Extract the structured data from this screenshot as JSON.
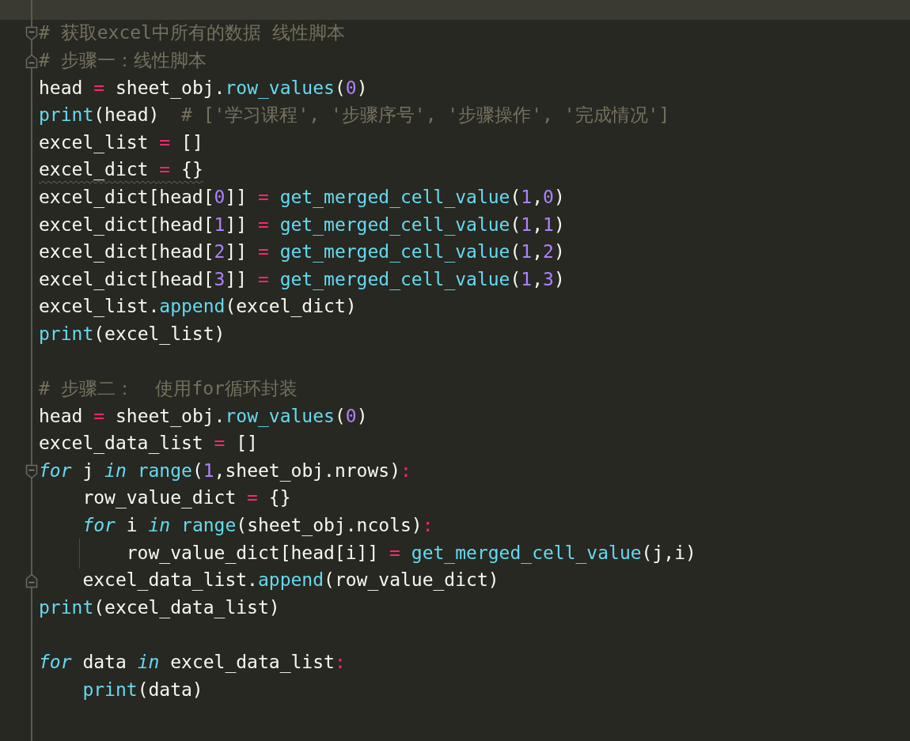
{
  "editor": {
    "lines": [
      {
        "kind": "code",
        "fold_start": true,
        "fold_end": false,
        "squiggle": false,
        "guide": false,
        "segments": [
          {
            "kind": "cm",
            "text": "# 获取excel中所有的数据 线性脚本"
          }
        ]
      },
      {
        "kind": "code",
        "fold_start": false,
        "fold_end": true,
        "squiggle": false,
        "guide": false,
        "segments": [
          {
            "kind": "cm",
            "text": "# 步骤一：线性脚本"
          }
        ]
      },
      {
        "kind": "code",
        "fold_start": false,
        "fold_end": false,
        "squiggle": false,
        "guide": false,
        "segments": [
          {
            "kind": "t",
            "text": "head "
          },
          {
            "kind": "op",
            "text": "="
          },
          {
            "kind": "t",
            "text": " sheet_obj."
          },
          {
            "kind": "fn",
            "text": "row_values"
          },
          {
            "kind": "t",
            "text": "("
          },
          {
            "kind": "num",
            "text": "0"
          },
          {
            "kind": "t",
            "text": ")"
          }
        ]
      },
      {
        "kind": "code",
        "fold_start": false,
        "fold_end": false,
        "squiggle": false,
        "guide": false,
        "segments": [
          {
            "kind": "fn",
            "text": "print"
          },
          {
            "kind": "t",
            "text": "(head)  "
          },
          {
            "kind": "cm",
            "text": "# ['学习课程', '步骤序号', '步骤操作', '完成情况']"
          }
        ]
      },
      {
        "kind": "code",
        "fold_start": false,
        "fold_end": false,
        "squiggle": false,
        "guide": false,
        "segments": [
          {
            "kind": "t",
            "text": "excel_list "
          },
          {
            "kind": "op",
            "text": "="
          },
          {
            "kind": "t",
            "text": " []"
          }
        ]
      },
      {
        "kind": "code",
        "fold_start": false,
        "fold_end": false,
        "squiggle": true,
        "guide": false,
        "segments": [
          {
            "kind": "t",
            "text": "excel_dict "
          },
          {
            "kind": "op",
            "text": "="
          },
          {
            "kind": "t",
            "text": " {}"
          }
        ]
      },
      {
        "kind": "code",
        "fold_start": false,
        "fold_end": false,
        "squiggle": false,
        "guide": false,
        "segments": [
          {
            "kind": "t",
            "text": "excel_dict[head["
          },
          {
            "kind": "num",
            "text": "0"
          },
          {
            "kind": "t",
            "text": "]] "
          },
          {
            "kind": "op",
            "text": "= "
          },
          {
            "kind": "fn",
            "text": "get_merged_cell_value"
          },
          {
            "kind": "t",
            "text": "("
          },
          {
            "kind": "num",
            "text": "1"
          },
          {
            "kind": "t",
            "text": ","
          },
          {
            "kind": "num",
            "text": "0"
          },
          {
            "kind": "t",
            "text": ")"
          }
        ]
      },
      {
        "kind": "code",
        "fold_start": false,
        "fold_end": false,
        "squiggle": false,
        "guide": false,
        "segments": [
          {
            "kind": "t",
            "text": "excel_dict[head["
          },
          {
            "kind": "num",
            "text": "1"
          },
          {
            "kind": "t",
            "text": "]] "
          },
          {
            "kind": "op",
            "text": "= "
          },
          {
            "kind": "fn",
            "text": "get_merged_cell_value"
          },
          {
            "kind": "t",
            "text": "("
          },
          {
            "kind": "num",
            "text": "1"
          },
          {
            "kind": "t",
            "text": ","
          },
          {
            "kind": "num",
            "text": "1"
          },
          {
            "kind": "t",
            "text": ")"
          }
        ]
      },
      {
        "kind": "code",
        "fold_start": false,
        "fold_end": false,
        "squiggle": false,
        "guide": false,
        "segments": [
          {
            "kind": "t",
            "text": "excel_dict[head["
          },
          {
            "kind": "num",
            "text": "2"
          },
          {
            "kind": "t",
            "text": "]] "
          },
          {
            "kind": "op",
            "text": "= "
          },
          {
            "kind": "fn",
            "text": "get_merged_cell_value"
          },
          {
            "kind": "t",
            "text": "("
          },
          {
            "kind": "num",
            "text": "1"
          },
          {
            "kind": "t",
            "text": ","
          },
          {
            "kind": "num",
            "text": "2"
          },
          {
            "kind": "t",
            "text": ")"
          }
        ]
      },
      {
        "kind": "code",
        "fold_start": false,
        "fold_end": false,
        "squiggle": false,
        "guide": false,
        "segments": [
          {
            "kind": "t",
            "text": "excel_dict[head["
          },
          {
            "kind": "num",
            "text": "3"
          },
          {
            "kind": "t",
            "text": "]] "
          },
          {
            "kind": "op",
            "text": "= "
          },
          {
            "kind": "fn",
            "text": "get_merged_cell_value"
          },
          {
            "kind": "t",
            "text": "("
          },
          {
            "kind": "num",
            "text": "1"
          },
          {
            "kind": "t",
            "text": ","
          },
          {
            "kind": "num",
            "text": "3"
          },
          {
            "kind": "t",
            "text": ")"
          }
        ]
      },
      {
        "kind": "code",
        "fold_start": false,
        "fold_end": false,
        "squiggle": false,
        "guide": false,
        "segments": [
          {
            "kind": "t",
            "text": "excel_list."
          },
          {
            "kind": "fn",
            "text": "append"
          },
          {
            "kind": "t",
            "text": "(excel_dict)"
          }
        ]
      },
      {
        "kind": "code",
        "fold_start": false,
        "fold_end": false,
        "squiggle": false,
        "guide": false,
        "segments": [
          {
            "kind": "fn",
            "text": "print"
          },
          {
            "kind": "t",
            "text": "(excel_list)"
          }
        ]
      },
      {
        "kind": "blank"
      },
      {
        "kind": "code",
        "fold_start": false,
        "fold_end": false,
        "squiggle": false,
        "guide": false,
        "segments": [
          {
            "kind": "cm",
            "text": "# 步骤二：  使用for循环封装"
          }
        ]
      },
      {
        "kind": "code",
        "fold_start": false,
        "fold_end": false,
        "squiggle": false,
        "guide": false,
        "segments": [
          {
            "kind": "t",
            "text": "head "
          },
          {
            "kind": "op",
            "text": "="
          },
          {
            "kind": "t",
            "text": " sheet_obj."
          },
          {
            "kind": "fn",
            "text": "row_values"
          },
          {
            "kind": "t",
            "text": "("
          },
          {
            "kind": "num",
            "text": "0"
          },
          {
            "kind": "t",
            "text": ")"
          }
        ]
      },
      {
        "kind": "code",
        "fold_start": false,
        "fold_end": false,
        "squiggle": false,
        "guide": false,
        "segments": [
          {
            "kind": "t",
            "text": "excel_data_list "
          },
          {
            "kind": "op",
            "text": "="
          },
          {
            "kind": "t",
            "text": " []"
          }
        ]
      },
      {
        "kind": "code",
        "fold_start": true,
        "fold_end": false,
        "squiggle": false,
        "guide": false,
        "segments": [
          {
            "kind": "kw",
            "text": "for"
          },
          {
            "kind": "t",
            "text": " j "
          },
          {
            "kind": "kw",
            "text": "in "
          },
          {
            "kind": "fn",
            "text": "range"
          },
          {
            "kind": "t",
            "text": "("
          },
          {
            "kind": "num",
            "text": "1"
          },
          {
            "kind": "t",
            "text": ",sheet_obj.nrows)"
          },
          {
            "kind": "op",
            "text": ":"
          }
        ]
      },
      {
        "kind": "code",
        "fold_start": false,
        "fold_end": false,
        "squiggle": false,
        "guide": false,
        "segments": [
          {
            "kind": "t",
            "text": "    row_value_dict "
          },
          {
            "kind": "op",
            "text": "="
          },
          {
            "kind": "t",
            "text": " {}"
          }
        ]
      },
      {
        "kind": "code",
        "fold_start": false,
        "fold_end": false,
        "squiggle": false,
        "guide": false,
        "segments": [
          {
            "kind": "kw",
            "text": "    for"
          },
          {
            "kind": "t",
            "text": " i "
          },
          {
            "kind": "kw",
            "text": "in "
          },
          {
            "kind": "fn",
            "text": "range"
          },
          {
            "kind": "t",
            "text": "(sheet_obj.ncols)"
          },
          {
            "kind": "op",
            "text": ":"
          }
        ]
      },
      {
        "kind": "code",
        "fold_start": false,
        "fold_end": false,
        "squiggle": false,
        "guide": true,
        "segments": [
          {
            "kind": "t",
            "text": "        row_value_dict[head[i]] "
          },
          {
            "kind": "op",
            "text": "= "
          },
          {
            "kind": "fn",
            "text": "get_merged_cell_value"
          },
          {
            "kind": "t",
            "text": "(j,i)"
          }
        ]
      },
      {
        "kind": "code",
        "fold_start": false,
        "fold_end": true,
        "squiggle": false,
        "guide": false,
        "segments": [
          {
            "kind": "t",
            "text": "    excel_data_list."
          },
          {
            "kind": "fn",
            "text": "append"
          },
          {
            "kind": "t",
            "text": "(row_value_dict)"
          }
        ]
      },
      {
        "kind": "code",
        "fold_start": false,
        "fold_end": false,
        "squiggle": false,
        "guide": false,
        "segments": [
          {
            "kind": "fn",
            "text": "print"
          },
          {
            "kind": "t",
            "text": "(excel_data_list)"
          }
        ]
      },
      {
        "kind": "blank"
      },
      {
        "kind": "code",
        "fold_start": false,
        "fold_end": false,
        "squiggle": false,
        "guide": false,
        "segments": [
          {
            "kind": "kw",
            "text": "for"
          },
          {
            "kind": "t",
            "text": " data "
          },
          {
            "kind": "kw",
            "text": "in"
          },
          {
            "kind": "t",
            "text": " excel_data_list"
          },
          {
            "kind": "op",
            "text": ":"
          }
        ]
      },
      {
        "kind": "code",
        "fold_start": false,
        "fold_end": false,
        "squiggle": false,
        "guide": false,
        "segments": [
          {
            "kind": "fn",
            "text": "    print"
          },
          {
            "kind": "t",
            "text": "(data)"
          }
        ]
      }
    ]
  }
}
